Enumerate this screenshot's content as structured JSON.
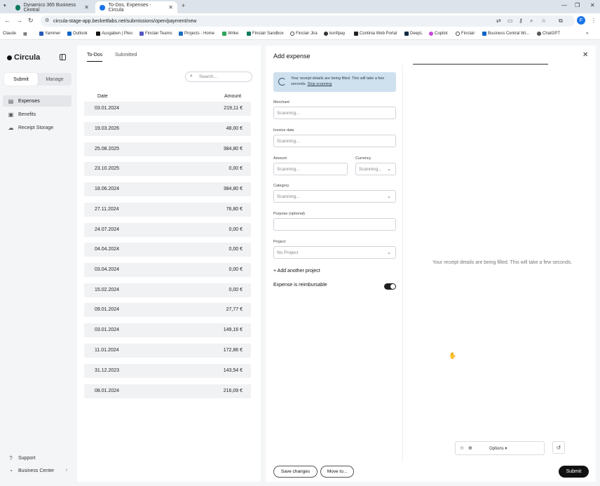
{
  "browser": {
    "tabs": [
      {
        "title": "Dynamics 365 Business Central",
        "active": false
      },
      {
        "title": "To-Dos, Expenses - Circula",
        "active": true
      }
    ],
    "new_tab_icon": "plus-icon",
    "url": "circula-stage-app.beckettlabs.net/submissions/open/payment/new",
    "profile_initial": "F",
    "bookmarks": [
      "Claude",
      "Yammer",
      "Outlook",
      "Ausgaben | Pleo",
      "Finclair Teams",
      "Projects - Home",
      "Wrike",
      "Finclair Sandbox",
      "Finclair Jira",
      "konfipay",
      "Continia Web Portal",
      "DeepL",
      "Copilot",
      "Finclair",
      "Business Central Wi...",
      "ChatGPT"
    ]
  },
  "sidebar": {
    "brand": "Circula",
    "segment": {
      "submit": "Submit",
      "manage": "Manage"
    },
    "items": [
      {
        "label": "Expenses",
        "icon": "receipt-icon"
      },
      {
        "label": "Benefits",
        "icon": "gift-icon"
      },
      {
        "label": "Receipt Storage",
        "icon": "cloud-icon"
      }
    ],
    "footer": [
      {
        "label": "Support",
        "icon": "help-icon"
      },
      {
        "label": "Business Center",
        "icon": "user-icon"
      }
    ]
  },
  "list": {
    "tabs": [
      "To-Dos",
      "Submitted"
    ],
    "search_placeholder": "Search...",
    "columns": {
      "date": "Date",
      "amount": "Amount"
    },
    "rows": [
      {
        "date": "03.01.2024",
        "amount": "219,11 €"
      },
      {
        "date": "19.03.2026",
        "amount": "48,00 €"
      },
      {
        "date": "25.08.2025",
        "amount": "384,80 €"
      },
      {
        "date": "23.10.2025",
        "amount": "0,00 €"
      },
      {
        "date": "18.06.2024",
        "amount": "384,80 €"
      },
      {
        "date": "27.11.2024",
        "amount": "76,80 €"
      },
      {
        "date": "24.07.2024",
        "amount": "0,00 €"
      },
      {
        "date": "04.04.2024",
        "amount": "0,00 €"
      },
      {
        "date": "03.04.2024",
        "amount": "0,00 €"
      },
      {
        "date": "15.02.2024",
        "amount": "0,00 €"
      },
      {
        "date": "09.01.2024",
        "amount": "27,77 €"
      },
      {
        "date": "03.01.2024",
        "amount": "149,16 €"
      },
      {
        "date": "11.01.2024",
        "amount": "172,86 €"
      },
      {
        "date": "31.12.2023",
        "amount": "143,54 €"
      },
      {
        "date": "08.01.2024",
        "amount": "216,09 €"
      }
    ]
  },
  "form": {
    "title": "Add expense",
    "info": {
      "text": "Your receipt details are being filled. This will take a few seconds.",
      "link": "Stop scanning"
    },
    "fields": {
      "merchant": {
        "label": "Merchant",
        "value": "Scanning..."
      },
      "invoice_date": {
        "label": "Invoice date",
        "value": "Scanning..."
      },
      "amount": {
        "label": "Amount",
        "value": "Scanning..."
      },
      "currency": {
        "label": "Currency",
        "value": "Scanning..."
      },
      "category": {
        "label": "Category",
        "value": "Scanning..."
      },
      "purpose": {
        "label": "Purpose (optional)",
        "value": ""
      },
      "project": {
        "label": "Project",
        "value": "No Project"
      }
    },
    "add_project": "+ Add another project",
    "reimbursable": {
      "label": "Expense is reimbursable",
      "on": true
    },
    "preview_message": "Your receipt details are being filled. This will take a few seconds.",
    "viewer": {
      "options": "Options"
    },
    "buttons": {
      "save": "Save changes",
      "move": "Move to...",
      "submit": "Submit"
    }
  }
}
